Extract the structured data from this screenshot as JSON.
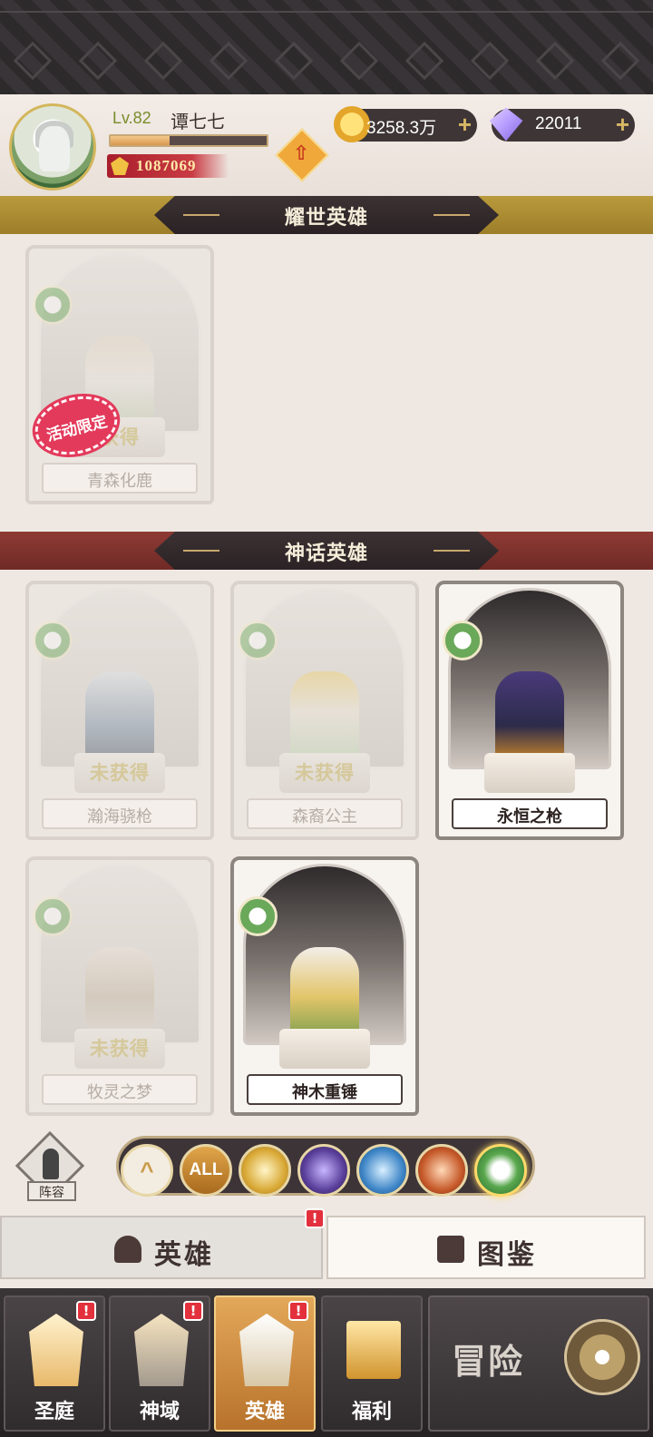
{
  "player": {
    "level": "Lv.82",
    "name": "谭七七",
    "exp_progress": 0.38,
    "power": "1087069"
  },
  "currency": {
    "gold": "3258.3万",
    "diamonds": "22011",
    "plus": "+"
  },
  "sections": {
    "glorious": "耀世英雄",
    "mythic": "神话英雄"
  },
  "heroes": {
    "qingsen": {
      "name": "青森化鹿",
      "status": "获得",
      "badge": "活动限定",
      "owned": false
    },
    "hanhai": {
      "name": "瀚海骁枪",
      "status": "未获得",
      "owned": false
    },
    "senyi": {
      "name": "森裔公主",
      "status": "未获得",
      "owned": false
    },
    "yongheng": {
      "name": "永恒之枪",
      "owned": true
    },
    "muling": {
      "name": "牧灵之梦",
      "status": "未获得",
      "owned": false
    },
    "shenmu": {
      "name": "神木重锤",
      "owned": true
    }
  },
  "filters": {
    "lineup_label": "阵容",
    "all_label": "ALL",
    "up_symbol": "^"
  },
  "tabs": {
    "heroes": "英雄",
    "codex": "图鉴",
    "alert": "!"
  },
  "nav": {
    "items": [
      "圣庭",
      "神域",
      "英雄",
      "福利"
    ],
    "adventure": "冒险",
    "alert": "!"
  },
  "colors": {
    "gold_banner": "#b99a3c",
    "red_banner": "#8f3a34",
    "active_nav": "#e3a85a",
    "alert": "#e2303c"
  }
}
